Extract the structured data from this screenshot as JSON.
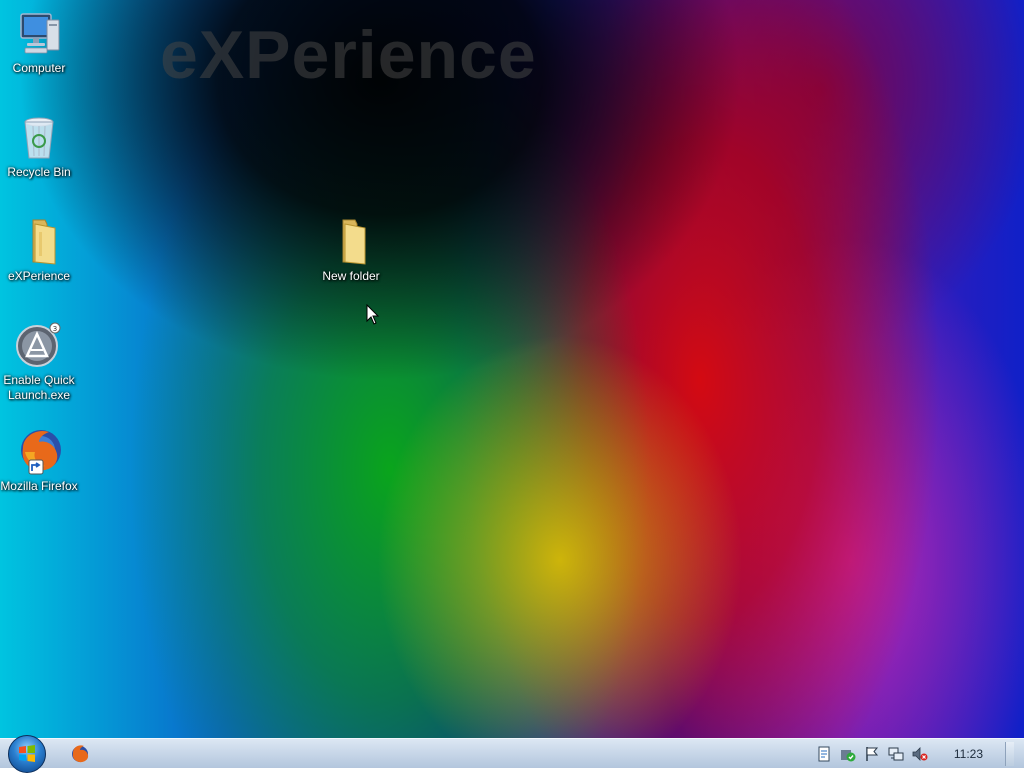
{
  "desktop": {
    "watermark": "eXPerience",
    "icons": [
      {
        "label": "Computer",
        "icon": "computer-icon"
      },
      {
        "label": "Recycle Bin",
        "icon": "recycle-bin-icon"
      },
      {
        "label": "eXPerience",
        "icon": "folder-icon"
      },
      {
        "label": "Enable Quick Launch.exe",
        "icon": "quick-launch-app-icon"
      },
      {
        "label": "Mozilla Firefox",
        "icon": "firefox-icon"
      },
      {
        "label": "New folder",
        "icon": "folder-icon"
      }
    ]
  },
  "taskbar": {
    "start_icon": "windows-start-orb-icon",
    "pinned": [
      {
        "icon": "firefox-icon"
      }
    ],
    "tray": [
      "document-icon",
      "security-icon",
      "action-center-flag-icon",
      "network-icon",
      "volume-muted-icon"
    ],
    "clock": "11:23"
  },
  "colors": {
    "taskbar": "#c7d6e8",
    "label_text": "#ffffff",
    "clock_text": "#1c2a3a"
  }
}
